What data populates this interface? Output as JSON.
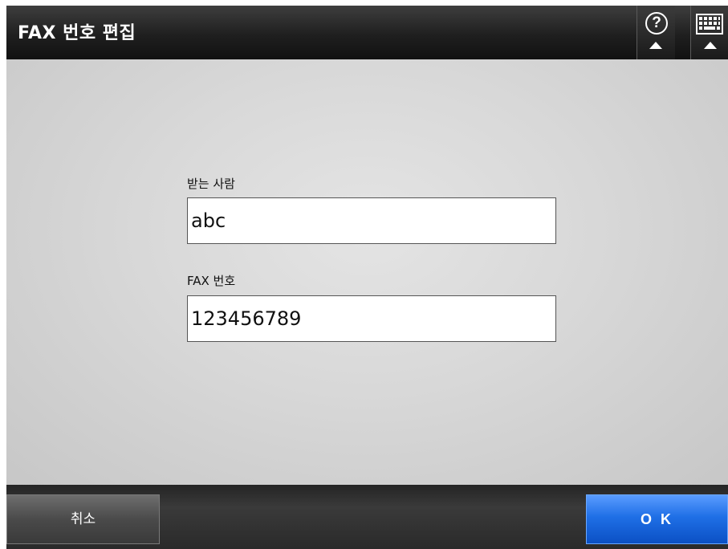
{
  "header": {
    "title": "FAX 번호 편집",
    "help_glyph": "?",
    "help_icon": "help-icon",
    "keyboard_icon": "keyboard-icon"
  },
  "form": {
    "recipient": {
      "label": "받는 사람",
      "value": "abc"
    },
    "fax_number": {
      "label": "FAX 번호",
      "value": "123456789"
    }
  },
  "footer": {
    "cancel_label": "취소",
    "ok_label": "O K"
  },
  "colors": {
    "header_bg": "#1f1f1f",
    "ok_accent": "#1f6fe6",
    "cancel_bg": "#4a4a4a"
  }
}
